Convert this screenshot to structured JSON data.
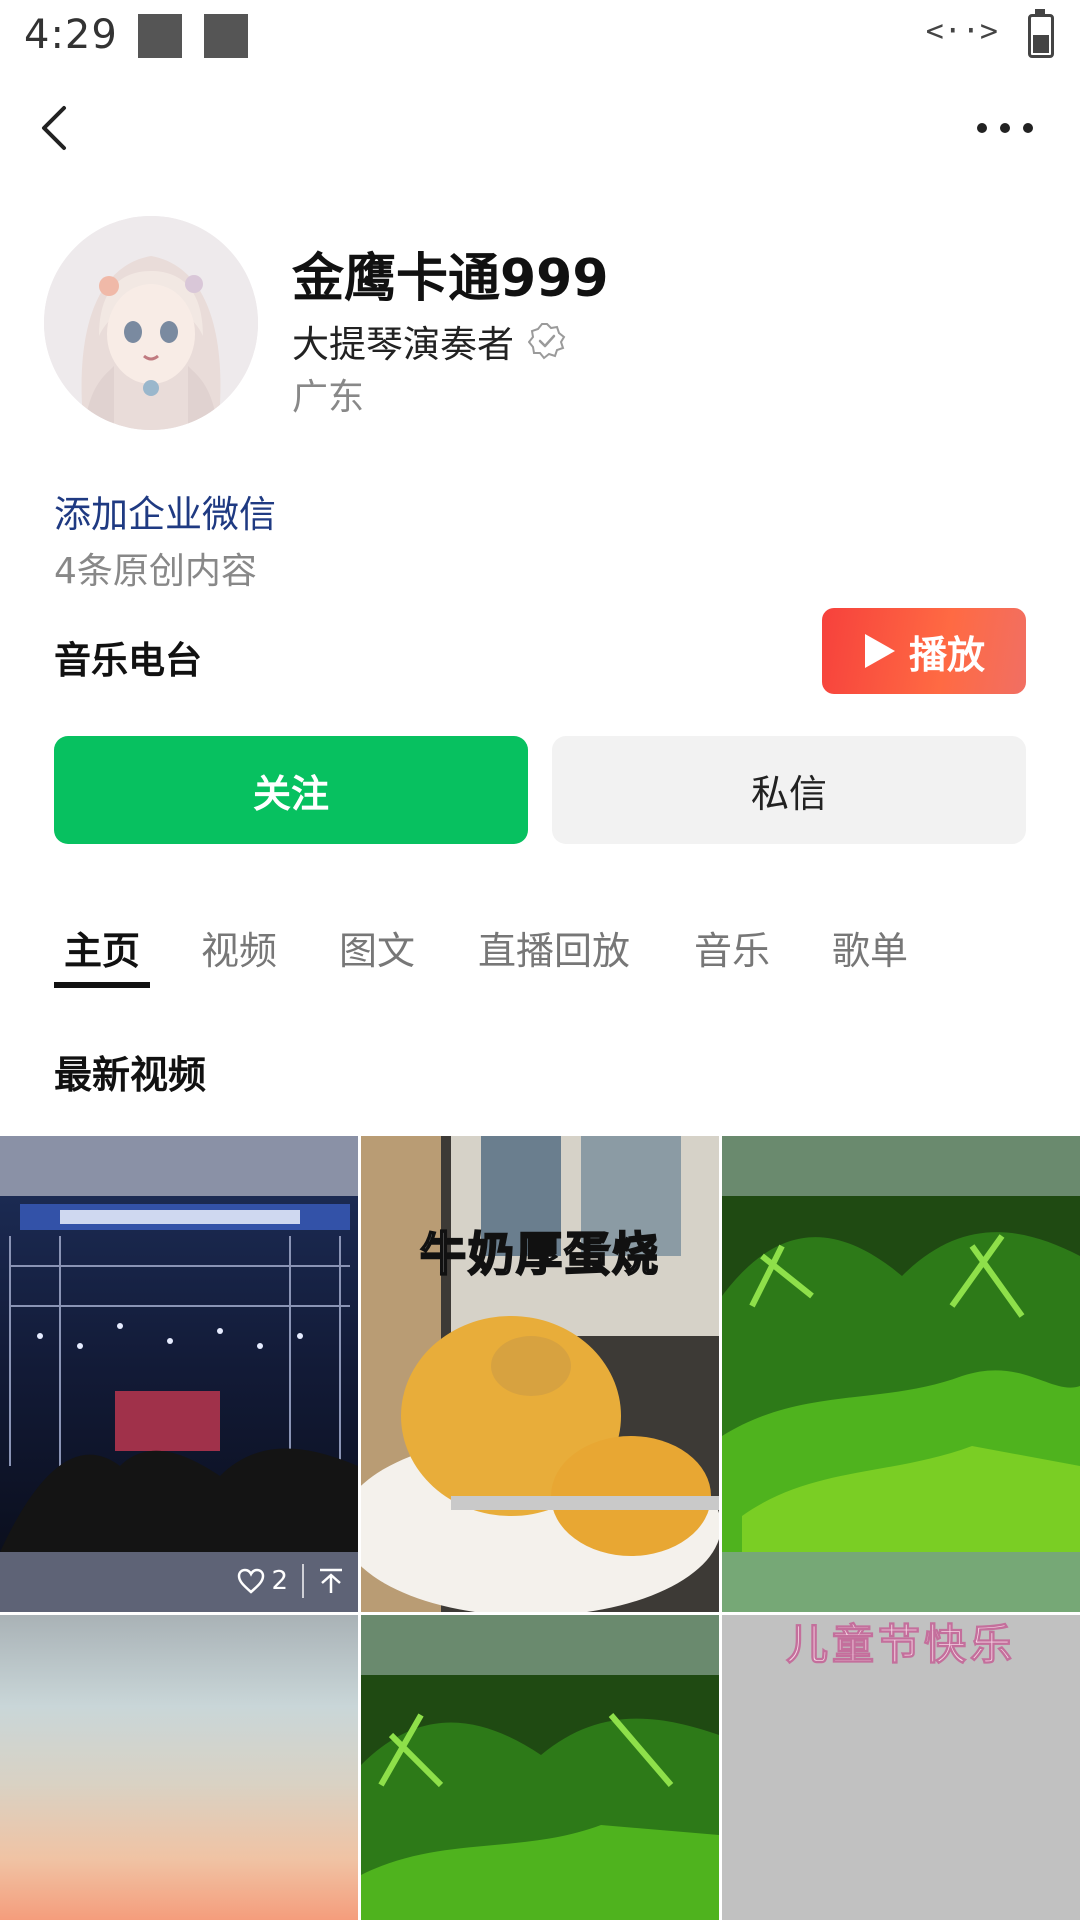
{
  "status_bar": {
    "time": "4:29",
    "network_icon": "<··>"
  },
  "navigation": {
    "back_icon": "chevron-left-icon",
    "more_icon": "more-horizontal-icon"
  },
  "profile": {
    "name": "金鹰卡通999",
    "title": "大提琴演奏者",
    "location": "广东",
    "wecom_link": "添加企业微信",
    "original_count": "4条原创内容"
  },
  "radio": {
    "label": "音乐电台",
    "play_label": "播放"
  },
  "actions": {
    "follow_label": "关注",
    "message_label": "私信"
  },
  "tabs": [
    {
      "label": "主页",
      "active": true
    },
    {
      "label": "视频",
      "active": false
    },
    {
      "label": "图文",
      "active": false
    },
    {
      "label": "直播回放",
      "active": false
    },
    {
      "label": "音乐",
      "active": false
    },
    {
      "label": "歌单",
      "active": false
    }
  ],
  "section": {
    "latest_videos_title": "最新视频"
  },
  "videos": [
    {
      "like_count": "2",
      "overlay_text": ""
    },
    {
      "like_count": "",
      "overlay_text": "牛奶厚蛋烧"
    },
    {
      "like_count": "",
      "overlay_text": ""
    },
    {
      "like_count": "",
      "overlay_text": ""
    },
    {
      "like_count": "",
      "overlay_text": ""
    },
    {
      "like_count": "",
      "overlay_text": "儿童节快乐"
    }
  ],
  "colors": {
    "follow_green": "#07c160",
    "play_red": "#f6413c",
    "link_blue": "#1f3a82"
  }
}
